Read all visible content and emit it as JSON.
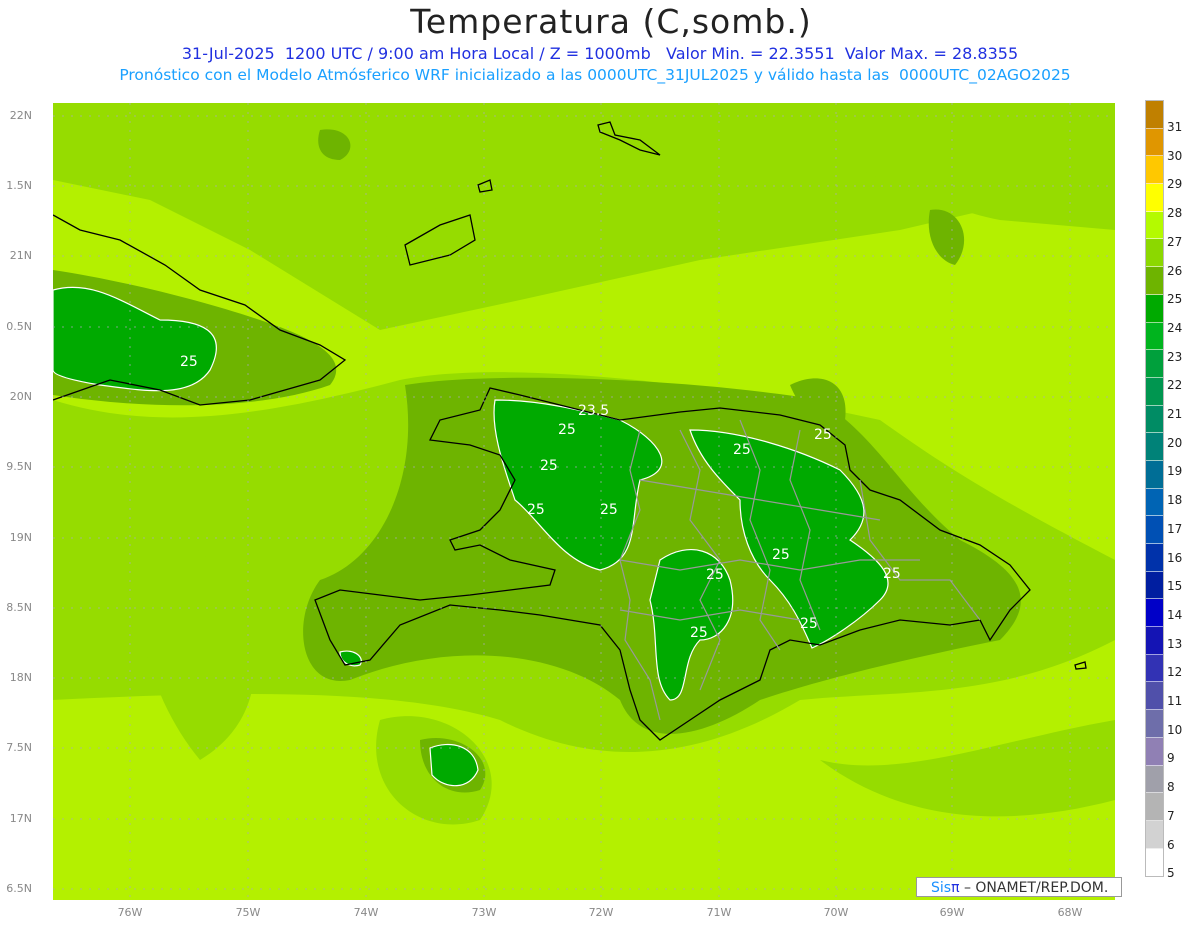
{
  "header": {
    "title": "Temperatura (C,somb.)",
    "subtitle1": "31-Jul-2025  1200 UTC / 9:00 am Hora Local / Z = 1000mb   Valor Min. = 22.3551  Valor Max. = 28.8355",
    "subtitle2": "Pronóstico con el Modelo Atmósferico WRF inicializado a las 0000UTC_31JUL2025 y válido hasta las  0000UTC_02AGO2025"
  },
  "axes": {
    "lat_labels": [
      "22N",
      "1.5N",
      "21N",
      "0.5N",
      "20N",
      "9.5N",
      "19N",
      "8.5N",
      "18N",
      "7.5N",
      "17N",
      "6.5N"
    ],
    "lon_labels": [
      "76W",
      "75W",
      "74W",
      "73W",
      "72W",
      "71W",
      "70W",
      "69W",
      "68W"
    ]
  },
  "colorbar": {
    "labels": [
      "31",
      "30",
      "29",
      "28",
      "27",
      "26",
      "25",
      "24",
      "23",
      "22",
      "21",
      "20",
      "19",
      "18",
      "17",
      "16",
      "15",
      "14",
      "13",
      "12",
      "11",
      "10",
      "9",
      "8",
      "7",
      "6",
      "5"
    ],
    "colors": [
      "#c08000",
      "#e09600",
      "#ffc800",
      "#ffff00",
      "#b4fa00",
      "#8cd800",
      "#6eb400",
      "#00aa00",
      "#00b41e",
      "#00a03c",
      "#009650",
      "#008c64",
      "#008278",
      "#006e96",
      "#0064b4",
      "#0050b4",
      "#0032aa",
      "#001ea0",
      "#0000c8",
      "#1414b4",
      "#3232b4",
      "#5050aa",
      "#6e6eaa",
      "#9080b4",
      "#a0a0aa",
      "#b4b4b4",
      "#d2d2d2",
      "#ffffff"
    ]
  },
  "contour_labels": [
    "25",
    "23.5",
    "25",
    "25",
    "25",
    "25",
    "25",
    "25",
    "25",
    "25",
    "25",
    "25",
    "25"
  ],
  "logo": {
    "sis": "Sis",
    "pi": "π",
    "text": " – ONAMET/REP.DOM."
  }
}
